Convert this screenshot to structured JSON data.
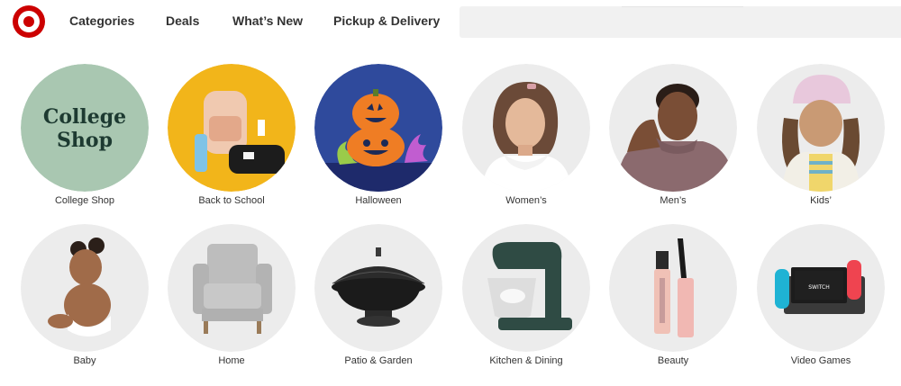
{
  "brand": {
    "name": "Target",
    "logo_icon": "target-bullseye-icon",
    "color": "#cc0000"
  },
  "nav": {
    "items": [
      {
        "label": "Categories"
      },
      {
        "label": "Deals"
      },
      {
        "label": "What’s New"
      },
      {
        "label": "Pickup & Delivery"
      }
    ]
  },
  "search": {
    "placeholder": ""
  },
  "categories": [
    {
      "label": "College Shop",
      "image_text_line1": "College",
      "image_text_line2": "Shop",
      "bg": "#a9c7b1"
    },
    {
      "label": "Back to School",
      "bg": "#f2b51a"
    },
    {
      "label": "Halloween",
      "bg": "#2f4a9c"
    },
    {
      "label": "Women’s",
      "bg": "#ececec"
    },
    {
      "label": "Men’s",
      "bg": "#ececec"
    },
    {
      "label": "Kids’",
      "bg": "#ececec"
    },
    {
      "label": "Baby",
      "bg": "#ececec"
    },
    {
      "label": "Home",
      "bg": "#ececec"
    },
    {
      "label": "Patio & Garden",
      "bg": "#ececec"
    },
    {
      "label": "Kitchen & Dining",
      "bg": "#ececec"
    },
    {
      "label": "Beauty",
      "bg": "#ececec"
    },
    {
      "label": "Video Games",
      "bg": "#ececec"
    }
  ]
}
